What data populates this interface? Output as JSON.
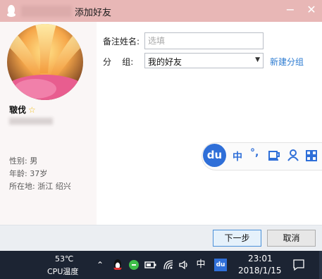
{
  "window": {
    "title": "添加好友",
    "minimize_glyph": "−",
    "close_glyph": "✕"
  },
  "profile": {
    "nickname": "皲伐",
    "gender_label": "性别",
    "gender": "男",
    "age_label": "年龄",
    "age": "37岁",
    "location_label": "所在地",
    "location": "浙江  绍兴"
  },
  "form": {
    "remark_label": "备注姓名:",
    "remark_placeholder": "选填",
    "group_label": "分    组:",
    "group_value": "我的好友",
    "new_group_link": "新建分组"
  },
  "ime_toolbar": {
    "logo": "du",
    "mode": "中",
    "punct": "°,"
  },
  "buttons": {
    "next": "下一步",
    "cancel": "取消"
  },
  "taskbar": {
    "temp": "53℃",
    "temp_label": "CPU温度",
    "ime_indicator": "中",
    "time": "23:01",
    "date": "2018/1/15"
  },
  "colors": {
    "titlebar": "#e8b7b6",
    "link": "#2c7bd1",
    "ime_blue": "#2f6fd8",
    "taskbar": "#1c2433"
  }
}
